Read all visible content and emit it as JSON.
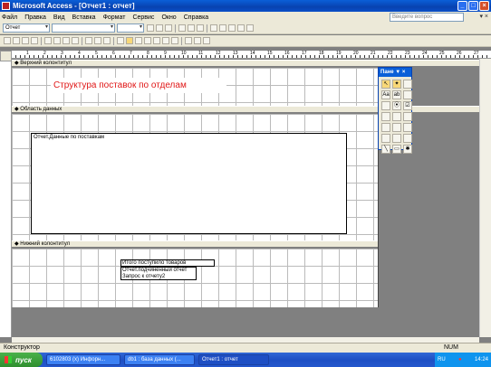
{
  "title": "Microsoft Access - [Отчет1 : отчет]",
  "menu": [
    "Файл",
    "Правка",
    "Вид",
    "Вставка",
    "Формат",
    "Сервис",
    "Окно",
    "Справка"
  ],
  "help_placeholder": "Введите вопрос",
  "object_combo": "Отчет",
  "ruler_marks": [
    "1",
    "2",
    "3",
    "4",
    "5",
    "6",
    "7",
    "8",
    "9",
    "10",
    "11",
    "12",
    "13",
    "14",
    "15",
    "16",
    "17",
    "18",
    "19",
    "20",
    "21",
    "22",
    "23",
    "24",
    "25",
    "26",
    "27"
  ],
  "sections": {
    "header": "Верхний колонтитул",
    "data": "Область данных",
    "footer": "Нижний колонтитул"
  },
  "report_title": "Структура поставок по отделам",
  "subform_label": "Отчет.Данные по поставкам",
  "total_label": "Итого поступило товаров",
  "subreport_lines": [
    "Отчет.подчиненный отчет",
    "Запрос к отчету2"
  ],
  "toolbox_title": "Пане ▼ ×",
  "status": "Конструктор",
  "status_num": "NUM",
  "taskbar": {
    "start": "пуск",
    "tasks": [
      "6102803 (x) Инфорн...",
      "db1 : база данных (...",
      "Отчет1 : отчет"
    ],
    "lang": "RU",
    "time": "14:24"
  }
}
